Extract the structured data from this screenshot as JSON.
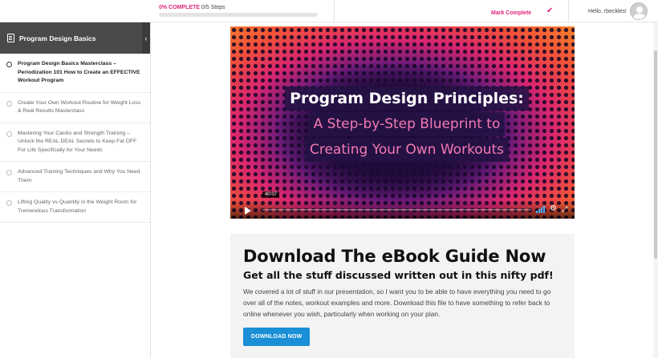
{
  "topbar": {
    "progress_pct": "0% COMPLETE",
    "progress_steps": "0/5 Steps",
    "progress_fraction": 0,
    "mark_complete": "Mark Complete",
    "greeting": "Hello, rbeckles!"
  },
  "sidebar": {
    "title": "Program Design Basics",
    "items": [
      {
        "label": "Program Design Basics Masterclass – Periodization 101 How to Create an EFFECTIVE Workout Program",
        "active": true
      },
      {
        "label": "Create Your Own Workout Routine for Weight Loss & Real Results Masterclass",
        "active": false
      },
      {
        "label": "Mastering Your Cardio and Strength Training – Unlock the REAL DEAL Secrets to Keep Fat OFF For Life Specifically for Your Needs",
        "active": false
      },
      {
        "label": "Advanced Training Techniques and Why You Need Them",
        "active": false
      },
      {
        "label": "Lifting Quality vs Quantity in the Weight Room for Tremendous Transformation",
        "active": false
      }
    ]
  },
  "video": {
    "line1": "Program Design Principles:",
    "line2": "A Step-by-Step Blueprint to",
    "line3": "Creating Your Own Workouts",
    "duration": "40:07"
  },
  "ebook": {
    "heading": "Download The eBook Guide Now",
    "subheading": "Get all the stuff discussed written out in this nifty pdf!",
    "body": "We covered a lot of stuff in our presentation, so I want you to be able to have everything you need to go over all of the notes, workout examples and more. Download this file to have something to refer back to online whenever you wish, particularly when working on your plan.",
    "button": "DOWNLOAD NOW"
  },
  "colors": {
    "accent": "#e0257c",
    "button": "#1a8fd6",
    "sidebar_header": "#4a4a4a"
  }
}
